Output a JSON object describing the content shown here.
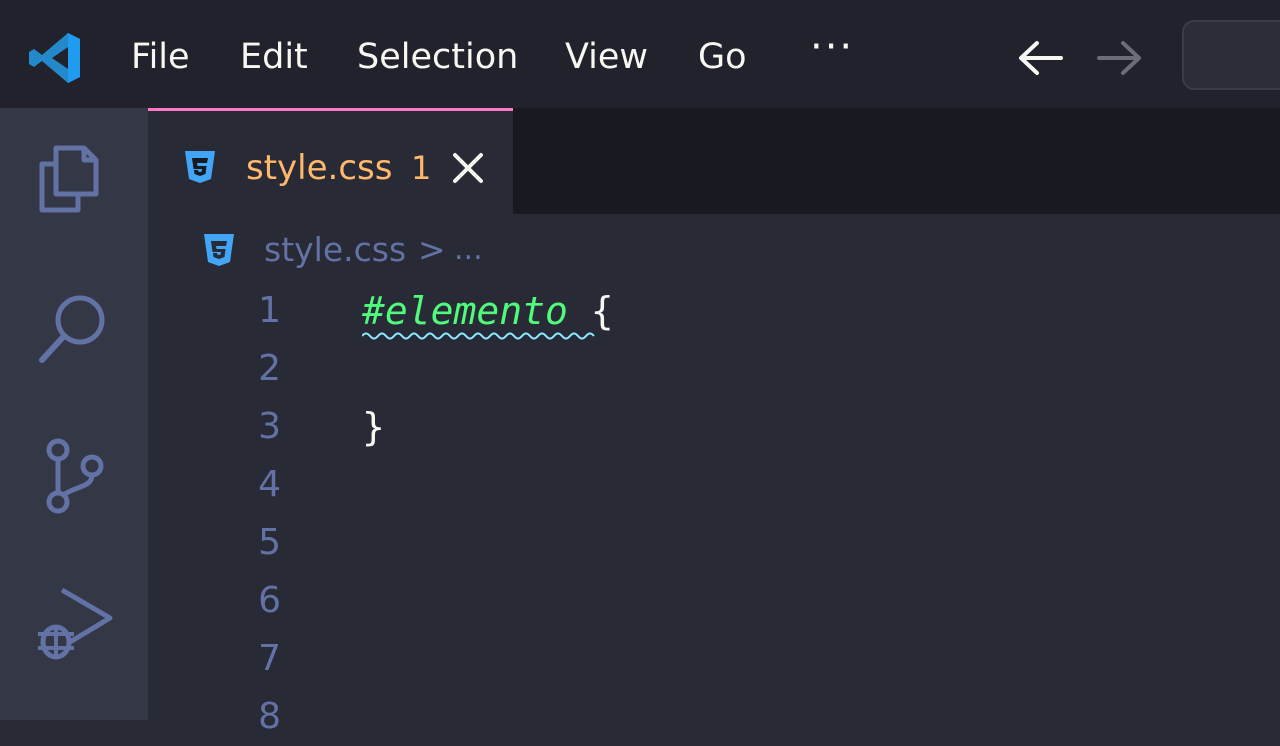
{
  "menu": {
    "file": "File",
    "edit": "Edit",
    "selection": "Selection",
    "view": "View",
    "go": "Go",
    "more": "···"
  },
  "tab": {
    "filename": "style.css",
    "problem_count": "1"
  },
  "breadcrumb": {
    "file": "style.css",
    "separator": ">",
    "ellipsis": "..."
  },
  "editor": {
    "line_numbers": [
      "1",
      "2",
      "3",
      "4",
      "5",
      "6",
      "7",
      "8"
    ],
    "lines": [
      {
        "selector": "#elemento",
        "rest": " {"
      },
      {
        "selector": "",
        "rest": ""
      },
      {
        "selector": "",
        "rest": "}"
      }
    ]
  },
  "colors": {
    "accent": "#ff79c6",
    "tab_text": "#ffb86c",
    "selector": "#50fa7b",
    "warning_squiggle": "#8be9fd",
    "css_icon": "#42a5f5"
  }
}
